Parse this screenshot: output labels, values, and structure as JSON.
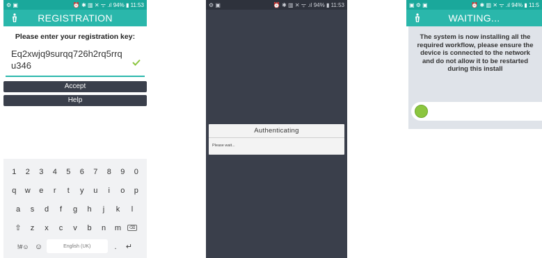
{
  "colors": {
    "teal": "#2ab7ab",
    "status_teal": "#1aa89b",
    "dark_button": "#3a3f4b",
    "progress_green": "#8cc63f"
  },
  "screen1": {
    "status": {
      "left": "⚙ ▣",
      "right": "⏰ ✱ ▥ ✕ ᯤ .ıl 94% ▮ 11:53"
    },
    "title": "REGISTRATION",
    "logo_icon": "app-logo-icon",
    "prompt": "Please enter your registration key:",
    "key_value": "Eq2xwjq9surqq726h2rq5rrq u346",
    "accept_label": "Accept",
    "help_label": "Help",
    "keyboard": {
      "row1": [
        "1",
        "2",
        "3",
        "4",
        "5",
        "6",
        "7",
        "8",
        "9",
        "0"
      ],
      "row2": [
        "q",
        "w",
        "e",
        "r",
        "t",
        "y",
        "u",
        "i",
        "o",
        "p"
      ],
      "row3": [
        "a",
        "s",
        "d",
        "f",
        "g",
        "h",
        "j",
        "k",
        "l"
      ],
      "row4": [
        "z",
        "x",
        "c",
        "v",
        "b",
        "n",
        "m"
      ],
      "symbols_label": "!#☺",
      "emoji_label": "☺",
      "space_label": "English (UK)",
      "period_label": ".",
      "backspace_label": "⌫",
      "enter_label": "↵",
      "shift_label": "⇧"
    }
  },
  "screen2": {
    "status": {
      "left": "⚙ ▣",
      "right": "⏰ ✱ ▥ ✕ ᯤ .ıl 94% ▮ 11:53"
    },
    "dialog_title": "Authenticating",
    "dialog_message": "Please wait..."
  },
  "screen3": {
    "status": {
      "left": "▣ ⚙ ▣",
      "right": "⏰ ✱ ▥ ✕ ᯤ .ıl 94% ▮ 11:5"
    },
    "title": "WAITING...",
    "message": "The system is now installing all the required workflow, please ensure the device is connected to the network and do not allow it to be restarted during this install",
    "progress": 0.05
  }
}
